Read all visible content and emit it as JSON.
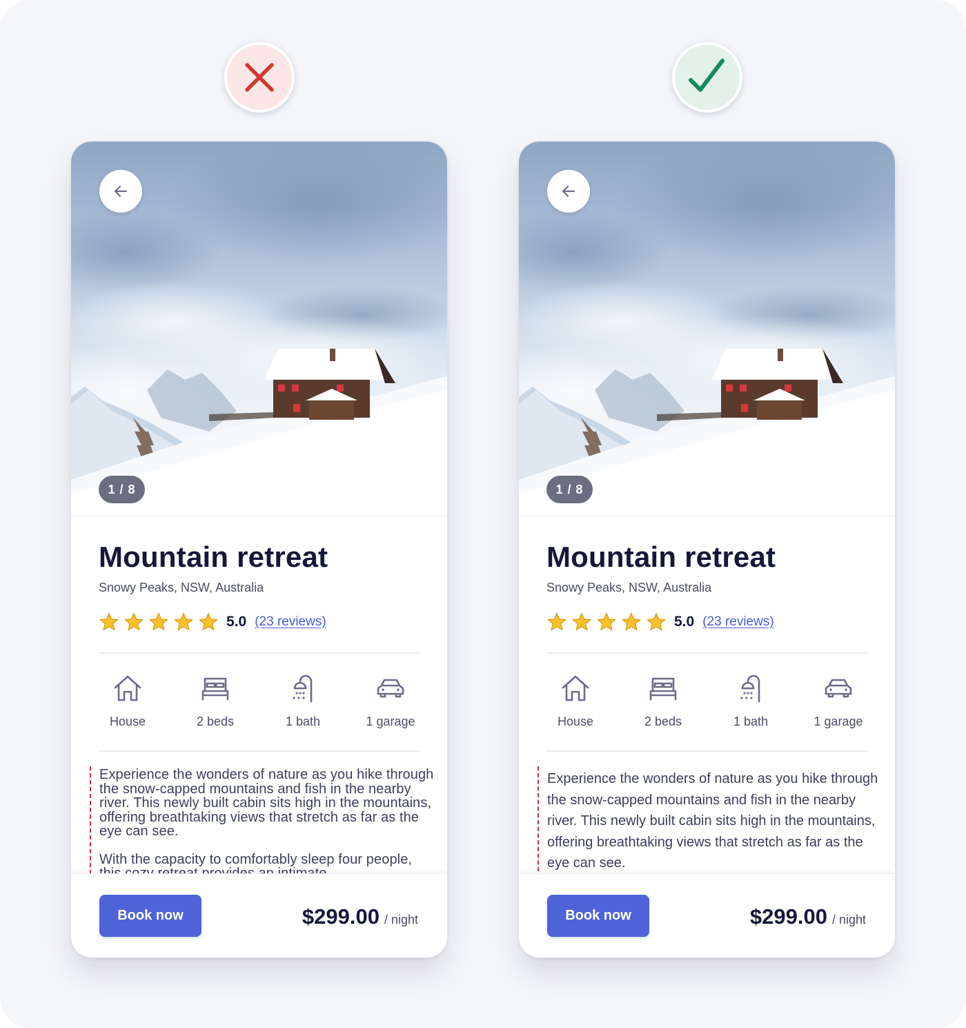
{
  "page": {
    "comparison": [
      {
        "verdict": "bad",
        "verdict_icon": "x-icon",
        "verdict_color": "#d03a31",
        "verdict_bg": "#fbe6e6"
      },
      {
        "verdict": "good",
        "verdict_icon": "check-icon",
        "verdict_color": "#168a5b",
        "verdict_bg": "#e3f1ea"
      }
    ]
  },
  "listing": {
    "gallery_counter": "1 / 8",
    "back_icon": "arrow-left-icon",
    "title": "Mountain retreat",
    "location": "Snowy Peaks, NSW, Australia",
    "rating": 5,
    "rating_max": 5,
    "rating_label": "5.0",
    "reviews_link": "(23 reviews)",
    "star_color": "#fbbf2a",
    "features": [
      {
        "icon": "house-icon",
        "label": "House"
      },
      {
        "icon": "bed-icon",
        "label": "2 beds"
      },
      {
        "icon": "shower-icon",
        "label": "1 bath"
      },
      {
        "icon": "car-icon",
        "label": "1 garage"
      }
    ],
    "description": [
      "Experience the wonders of nature as you hike through the snow-capped mountains and fish in the nearby river. This newly built cabin sits high in the mountains, offering breathtaking views that stretch as far as the eye can see.",
      "With the capacity to comfortably sleep four people, this cozy retreat provides an intimate"
    ],
    "book_button": "Book now",
    "price": "$299.00",
    "price_unit": "/ night",
    "accent_color": "#4f63d8"
  }
}
